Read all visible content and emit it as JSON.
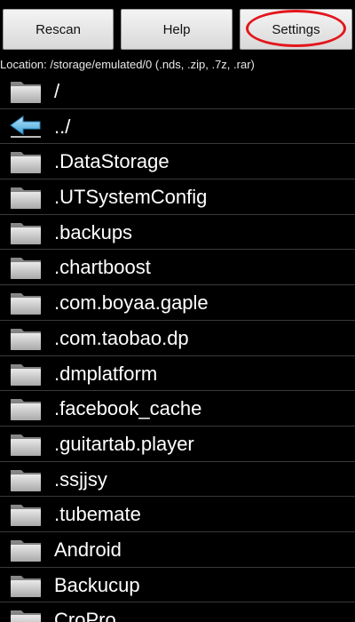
{
  "toolbar": {
    "rescan_label": "Rescan",
    "help_label": "Help",
    "settings_label": "Settings"
  },
  "annotation_color": "#e3161c",
  "location": "Location: /storage/emulated/0 (.nds, .zip, .7z, .rar)",
  "icons": {
    "folder": "folder-icon",
    "up": "back-arrow-icon"
  },
  "files": [
    {
      "name": "/",
      "icon": "folder"
    },
    {
      "name": "../",
      "icon": "up"
    },
    {
      "name": ".DataStorage",
      "icon": "folder"
    },
    {
      "name": ".UTSystemConfig",
      "icon": "folder"
    },
    {
      "name": ".backups",
      "icon": "folder"
    },
    {
      "name": ".chartboost",
      "icon": "folder"
    },
    {
      "name": ".com.boyaa.gaple",
      "icon": "folder"
    },
    {
      "name": ".com.taobao.dp",
      "icon": "folder"
    },
    {
      "name": ".dmplatform",
      "icon": "folder"
    },
    {
      "name": ".facebook_cache",
      "icon": "folder"
    },
    {
      "name": ".guitartab.player",
      "icon": "folder"
    },
    {
      "name": ".ssjjsy",
      "icon": "folder"
    },
    {
      "name": ".tubemate",
      "icon": "folder"
    },
    {
      "name": "Android",
      "icon": "folder"
    },
    {
      "name": "Backucup",
      "icon": "folder"
    },
    {
      "name": "CroPro",
      "icon": "folder"
    }
  ]
}
